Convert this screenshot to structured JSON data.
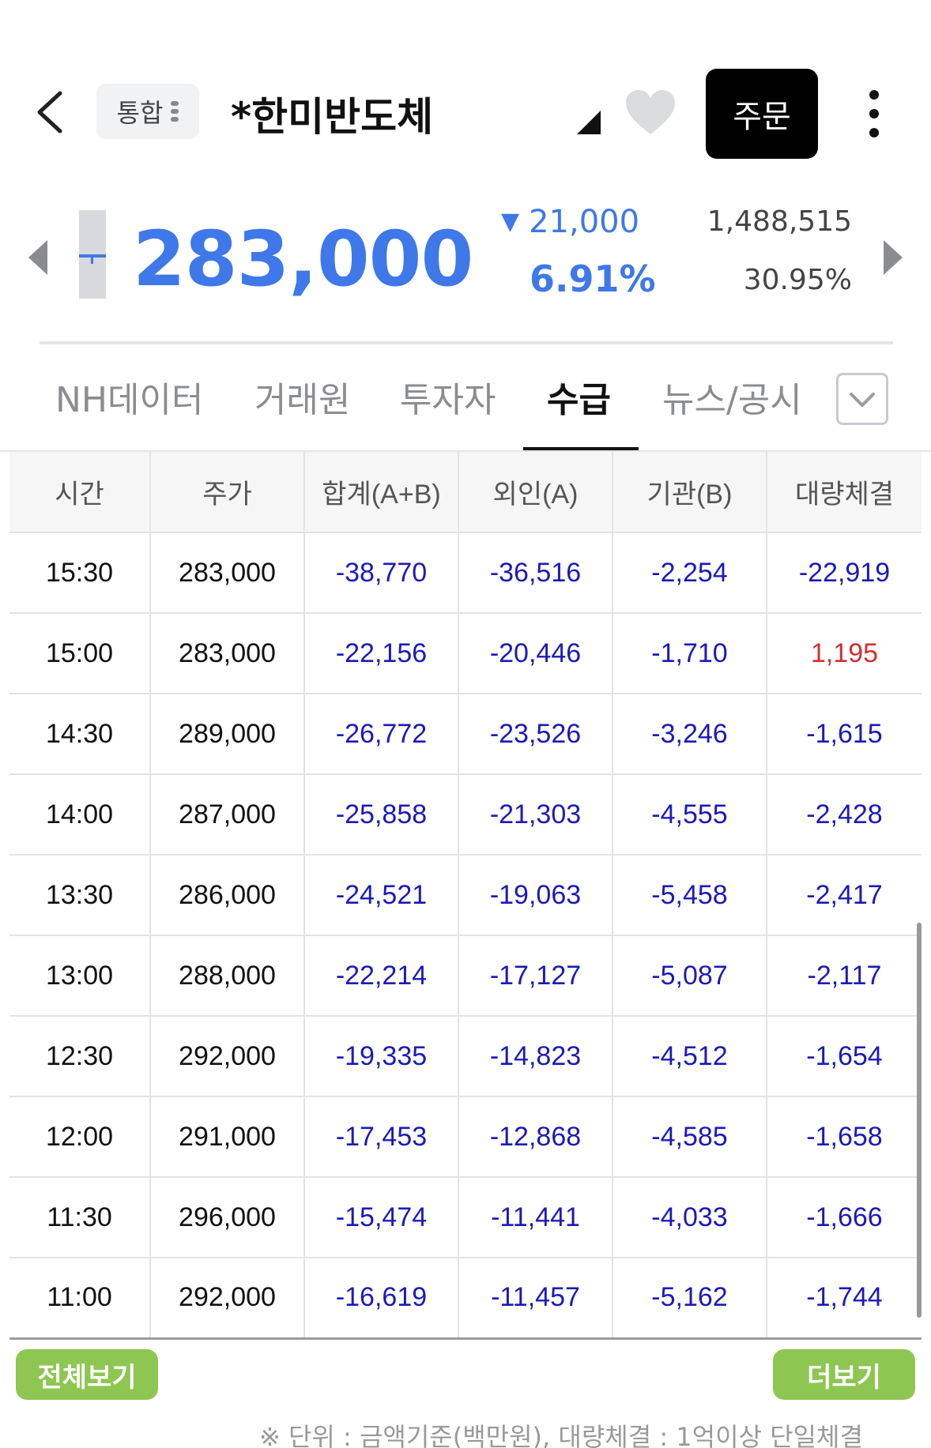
{
  "header": {
    "market_chip": "통합",
    "stock_name": "*한미반도체",
    "order_label": "주문"
  },
  "price": {
    "current": "283,000",
    "change_amount": "21,000",
    "change_pct": "6.91%",
    "volume": "1,488,515",
    "volume_ratio": "30.95%",
    "change_direction": "down"
  },
  "tabs": [
    {
      "label": "NH데이터"
    },
    {
      "label": "거래원"
    },
    {
      "label": "투자자"
    },
    {
      "label": "수급",
      "active": true
    },
    {
      "label": "뉴스/공시"
    }
  ],
  "table": {
    "headers": [
      "시간",
      "주가",
      "합계(A+B)",
      "외인(A)",
      "기관(B)",
      "대량체결"
    ],
    "rows": [
      [
        "15:30",
        "283,000",
        "-38,770",
        "-36,516",
        "-2,254",
        "-22,919"
      ],
      [
        "15:00",
        "283,000",
        "-22,156",
        "-20,446",
        "-1,710",
        "1,195"
      ],
      [
        "14:30",
        "289,000",
        "-26,772",
        "-23,526",
        "-3,246",
        "-1,615"
      ],
      [
        "14:00",
        "287,000",
        "-25,858",
        "-21,303",
        "-4,555",
        "-2,428"
      ],
      [
        "13:30",
        "286,000",
        "-24,521",
        "-19,063",
        "-5,458",
        "-2,417"
      ],
      [
        "13:00",
        "288,000",
        "-22,214",
        "-17,127",
        "-5,087",
        "-2,117"
      ],
      [
        "12:30",
        "292,000",
        "-19,335",
        "-14,823",
        "-4,512",
        "-1,654"
      ],
      [
        "12:00",
        "291,000",
        "-17,453",
        "-12,868",
        "-4,585",
        "-1,658"
      ],
      [
        "11:30",
        "296,000",
        "-15,474",
        "-11,441",
        "-4,033",
        "-1,666"
      ],
      [
        "11:00",
        "292,000",
        "-16,619",
        "-11,457",
        "-5,162",
        "-1,744"
      ]
    ]
  },
  "buttons": {
    "view_all": "전체보기",
    "more": "더보기"
  },
  "footnote": "※ 단위 : 금액기준(백만원), 대량체결 : 1억이상 단일체결",
  "colors": {
    "price_blue": "#3f78e8",
    "neg_blue": "#1c1ab8",
    "pos_red": "#d13030",
    "green_button": "#8ec652"
  }
}
